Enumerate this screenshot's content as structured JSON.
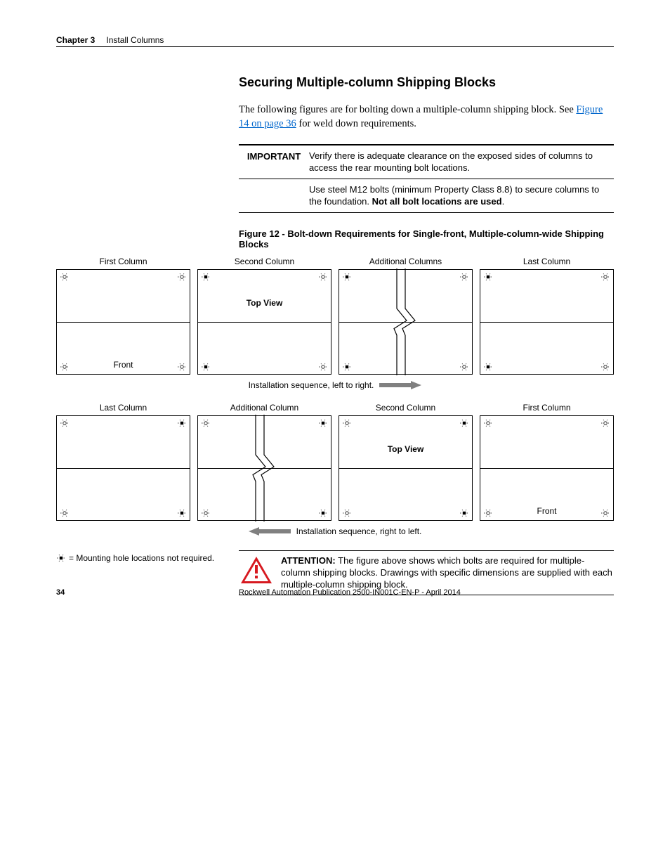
{
  "header": {
    "chapter": "Chapter 3",
    "title": "Install Columns"
  },
  "section": {
    "heading": "Securing Multiple-column Shipping Blocks",
    "intro_a": "The following figures are for bolting down a multiple-column shipping block. See ",
    "intro_link": "Figure 14 on page 36",
    "intro_b": " for weld down requirements."
  },
  "important": {
    "label": "IMPORTANT",
    "row1": "Verify there is adequate clearance on the exposed sides of columns to access the rear mounting bolt locations.",
    "row2_a": "Use steel M12 bolts (minimum Property Class 8.8) to secure columns to the foundation. ",
    "row2_b": "Not all bolt locations are used",
    "row2_c": "."
  },
  "figure": {
    "caption": "Figure 12 - Bolt-down Requirements for Single-front, Multiple-column-wide Shipping Blocks"
  },
  "diagram1": {
    "cols": [
      "First Column",
      "Second Column",
      "Additional Columns",
      "Last Column"
    ],
    "top_view": "Top View",
    "front": "Front",
    "seq": "Installation sequence, left to right."
  },
  "diagram2": {
    "cols": [
      "Last Column",
      "Additional Column",
      "Second Column",
      "First Column"
    ],
    "top_view": "Top View",
    "front": "Front",
    "seq": "Installation sequence, right to left."
  },
  "legend": {
    "text": " = Mounting hole locations not required."
  },
  "attention": {
    "label": "ATTENTION:",
    "text": " The figure above shows which bolts are required for multiple-column shipping blocks. Drawings with specific dimensions are supplied with each multiple-column shipping block."
  },
  "footer": {
    "page": "34",
    "pub": "Rockwell Automation Publication 2500-IN001C-EN-P - April 2014"
  }
}
